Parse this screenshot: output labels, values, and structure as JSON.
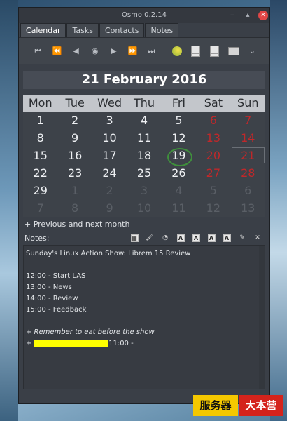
{
  "window": {
    "title": "Osmo 0.2.14",
    "minimize": "‒",
    "maximize": "▴",
    "close": "✕"
  },
  "tabs": [
    "Calendar",
    "Tasks",
    "Contacts",
    "Notes"
  ],
  "toolbar": {
    "icons": [
      "prev-year",
      "prev-month",
      "prev-day",
      "today",
      "next-day",
      "next-month",
      "next-year",
      "jump-to-date",
      "full-year",
      "date-calculator",
      "print",
      "menu"
    ]
  },
  "header": {
    "date": "21 February 2016"
  },
  "calendar": {
    "weekdays": [
      "Mon",
      "Tue",
      "Wed",
      "Thu",
      "Fri",
      "Sat",
      "Sun"
    ],
    "weeks": [
      [
        [
          "1",
          "cur"
        ],
        [
          "2",
          "cur"
        ],
        [
          "3",
          "cur"
        ],
        [
          "4",
          "cur"
        ],
        [
          "5",
          "cur"
        ],
        [
          "6",
          "we"
        ],
        [
          "7",
          "we"
        ]
      ],
      [
        [
          "8",
          "cur"
        ],
        [
          "9",
          "cur"
        ],
        [
          "10",
          "cur"
        ],
        [
          "11",
          "cur"
        ],
        [
          "12",
          "cur"
        ],
        [
          "13",
          "we"
        ],
        [
          "14",
          "we"
        ]
      ],
      [
        [
          "15",
          "cur"
        ],
        [
          "16",
          "cur"
        ],
        [
          "17",
          "cur"
        ],
        [
          "18",
          "cur"
        ],
        [
          "19",
          "today"
        ],
        [
          "20",
          "we"
        ],
        [
          "21",
          "sel"
        ]
      ],
      [
        [
          "22",
          "cur"
        ],
        [
          "23",
          "cur"
        ],
        [
          "24",
          "cur"
        ],
        [
          "25",
          "cur"
        ],
        [
          "26",
          "cur"
        ],
        [
          "27",
          "we"
        ],
        [
          "28",
          "we"
        ]
      ],
      [
        [
          "29",
          "cur"
        ],
        [
          "1",
          "oth"
        ],
        [
          "2",
          "oth"
        ],
        [
          "3",
          "oth"
        ],
        [
          "4",
          "oth"
        ],
        [
          "5",
          "oth"
        ],
        [
          "6",
          "oth"
        ]
      ],
      [
        [
          "7",
          "oth"
        ],
        [
          "8",
          "oth"
        ],
        [
          "9",
          "oth"
        ],
        [
          "10",
          "oth"
        ],
        [
          "11",
          "oth"
        ],
        [
          "12",
          "oth"
        ],
        [
          "13",
          "oth"
        ]
      ]
    ],
    "prevnext_label": "+ Previous and next month"
  },
  "notes": {
    "label": "Notes:",
    "lines": [
      "Sunday's Linux Action Show: Librem 15 Review",
      "",
      "12:00 - Start LAS",
      "13:00 - News",
      "14:00 - Review",
      "15:00 - Feedback",
      "",
      "+ Remember to eat before the show"
    ],
    "last_prefix": "+ ",
    "last_suffix": "11:00 -"
  },
  "watermark": {
    "left": "服务器",
    "right": "大本营"
  },
  "colors": {
    "weekend": "#c0282a",
    "today_ring": "#3f8f3c",
    "highlight": "#ffff00"
  }
}
